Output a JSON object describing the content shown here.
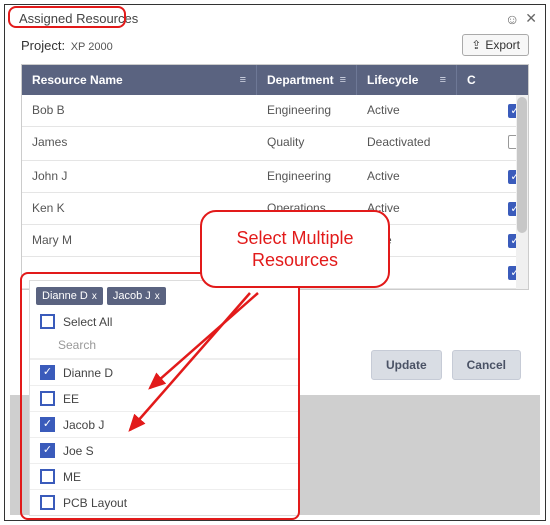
{
  "header": {
    "title": "Assigned Resources"
  },
  "project": {
    "label": "Project:",
    "name": "XP 2000"
  },
  "export_label": "Export",
  "grid": {
    "columns": {
      "resource": "Resource Name",
      "department": "Department",
      "lifecycle": "Lifecycle",
      "check": "C"
    },
    "rows": [
      {
        "name": "Bob B",
        "department": "Engineering",
        "lifecycle": "Active",
        "checked": true
      },
      {
        "name": "James",
        "department": "Quality",
        "lifecycle": "Deactivated",
        "checked": false
      },
      {
        "name": "John J",
        "department": "Engineering",
        "lifecycle": "Active",
        "checked": true
      },
      {
        "name": "Ken K",
        "department": "Operations",
        "lifecycle": "Active",
        "checked": true
      },
      {
        "name": "Mary M",
        "department": "",
        "lifecycle": "ctive",
        "checked": true
      },
      {
        "name": "",
        "department": "",
        "lifecycle": "",
        "checked": true
      }
    ]
  },
  "multiselect": {
    "chips": [
      "Dianne D",
      "Jacob J"
    ],
    "select_all_label": "Select All",
    "search_placeholder": "Search",
    "options": [
      {
        "label": "Dianne D",
        "checked": true
      },
      {
        "label": "EE",
        "checked": false
      },
      {
        "label": "Jacob J",
        "checked": true
      },
      {
        "label": "Joe S",
        "checked": true
      },
      {
        "label": "ME",
        "checked": false
      },
      {
        "label": "PCB Layout",
        "checked": false
      }
    ]
  },
  "actions": {
    "update": "Update",
    "cancel": "Cancel"
  },
  "annotation": {
    "callout_text": "Select Multiple Resources"
  }
}
